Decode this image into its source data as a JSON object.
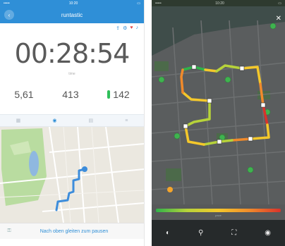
{
  "left_phone": {
    "status": {
      "carrier": "•••••",
      "time": "10:20",
      "battery": "▭"
    },
    "navbar": {
      "title": "runtastic",
      "back_icon": "chevron-left-icon"
    },
    "tools": {
      "icon_1": "share-icon",
      "icon_2": "gear-icon",
      "icon_3": "heart-icon",
      "icon_4": "music-icon"
    },
    "timer": {
      "value": "00:28:54",
      "sub": "time"
    },
    "stats": {
      "distance": "5,61",
      "calories": "413",
      "heart_rate": "142"
    },
    "tabs": {
      "tab_1": "dashboard-icon",
      "tab_2": "map-icon",
      "tab_3": "graph-icon",
      "tab_4": "split-icon"
    },
    "bottom": {
      "swipe_text": "Nach oben gleiten zum pausen",
      "lock_icon": "lock-icon"
    }
  },
  "right_phone": {
    "status": {
      "carrier": "•••••",
      "time": "10:20",
      "battery": "▭"
    },
    "close_icon": "close-icon",
    "legend_label": "pace",
    "toolbar": {
      "icon_1": "layers-icon",
      "icon_2": "location-pin-icon",
      "icon_3": "fullscreen-icon",
      "icon_4": "photo-icon"
    },
    "colors": {
      "route_left": "#3d8ddb",
      "fast": "#2fb24a",
      "medium": "#f4c82b",
      "slow": "#d9322b"
    }
  }
}
